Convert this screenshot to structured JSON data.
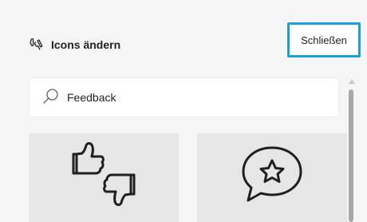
{
  "header": {
    "icon": "change-icons-icon",
    "title": "Icons ändern",
    "close_label": "Schließen"
  },
  "search": {
    "icon": "search-icon",
    "value": "Feedback"
  },
  "results": [
    {
      "icon": "thumbs-up-down-icon"
    },
    {
      "icon": "speech-bubble-star-icon"
    }
  ],
  "colors": {
    "focus_outline": "#1ba0d8",
    "tile_background": "#e6e6e6",
    "panel_background": "#f5f5f5"
  }
}
